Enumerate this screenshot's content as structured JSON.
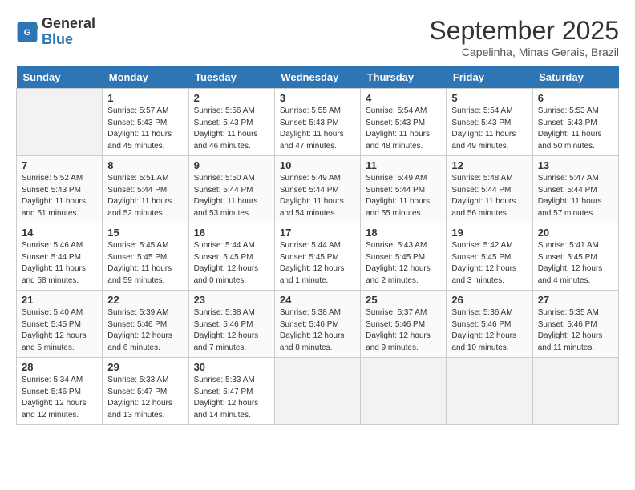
{
  "logo": {
    "line1": "General",
    "line2": "Blue"
  },
  "title": "September 2025",
  "location": "Capelinha, Minas Gerais, Brazil",
  "weekdays": [
    "Sunday",
    "Monday",
    "Tuesday",
    "Wednesday",
    "Thursday",
    "Friday",
    "Saturday"
  ],
  "weeks": [
    [
      {
        "day": "",
        "info": ""
      },
      {
        "day": "1",
        "info": "Sunrise: 5:57 AM\nSunset: 5:43 PM\nDaylight: 11 hours\nand 45 minutes."
      },
      {
        "day": "2",
        "info": "Sunrise: 5:56 AM\nSunset: 5:43 PM\nDaylight: 11 hours\nand 46 minutes."
      },
      {
        "day": "3",
        "info": "Sunrise: 5:55 AM\nSunset: 5:43 PM\nDaylight: 11 hours\nand 47 minutes."
      },
      {
        "day": "4",
        "info": "Sunrise: 5:54 AM\nSunset: 5:43 PM\nDaylight: 11 hours\nand 48 minutes."
      },
      {
        "day": "5",
        "info": "Sunrise: 5:54 AM\nSunset: 5:43 PM\nDaylight: 11 hours\nand 49 minutes."
      },
      {
        "day": "6",
        "info": "Sunrise: 5:53 AM\nSunset: 5:43 PM\nDaylight: 11 hours\nand 50 minutes."
      }
    ],
    [
      {
        "day": "7",
        "info": "Sunrise: 5:52 AM\nSunset: 5:43 PM\nDaylight: 11 hours\nand 51 minutes."
      },
      {
        "day": "8",
        "info": "Sunrise: 5:51 AM\nSunset: 5:44 PM\nDaylight: 11 hours\nand 52 minutes."
      },
      {
        "day": "9",
        "info": "Sunrise: 5:50 AM\nSunset: 5:44 PM\nDaylight: 11 hours\nand 53 minutes."
      },
      {
        "day": "10",
        "info": "Sunrise: 5:49 AM\nSunset: 5:44 PM\nDaylight: 11 hours\nand 54 minutes."
      },
      {
        "day": "11",
        "info": "Sunrise: 5:49 AM\nSunset: 5:44 PM\nDaylight: 11 hours\nand 55 minutes."
      },
      {
        "day": "12",
        "info": "Sunrise: 5:48 AM\nSunset: 5:44 PM\nDaylight: 11 hours\nand 56 minutes."
      },
      {
        "day": "13",
        "info": "Sunrise: 5:47 AM\nSunset: 5:44 PM\nDaylight: 11 hours\nand 57 minutes."
      }
    ],
    [
      {
        "day": "14",
        "info": "Sunrise: 5:46 AM\nSunset: 5:44 PM\nDaylight: 11 hours\nand 58 minutes."
      },
      {
        "day": "15",
        "info": "Sunrise: 5:45 AM\nSunset: 5:45 PM\nDaylight: 11 hours\nand 59 minutes."
      },
      {
        "day": "16",
        "info": "Sunrise: 5:44 AM\nSunset: 5:45 PM\nDaylight: 12 hours\nand 0 minutes."
      },
      {
        "day": "17",
        "info": "Sunrise: 5:44 AM\nSunset: 5:45 PM\nDaylight: 12 hours\nand 1 minute."
      },
      {
        "day": "18",
        "info": "Sunrise: 5:43 AM\nSunset: 5:45 PM\nDaylight: 12 hours\nand 2 minutes."
      },
      {
        "day": "19",
        "info": "Sunrise: 5:42 AM\nSunset: 5:45 PM\nDaylight: 12 hours\nand 3 minutes."
      },
      {
        "day": "20",
        "info": "Sunrise: 5:41 AM\nSunset: 5:45 PM\nDaylight: 12 hours\nand 4 minutes."
      }
    ],
    [
      {
        "day": "21",
        "info": "Sunrise: 5:40 AM\nSunset: 5:45 PM\nDaylight: 12 hours\nand 5 minutes."
      },
      {
        "day": "22",
        "info": "Sunrise: 5:39 AM\nSunset: 5:46 PM\nDaylight: 12 hours\nand 6 minutes."
      },
      {
        "day": "23",
        "info": "Sunrise: 5:38 AM\nSunset: 5:46 PM\nDaylight: 12 hours\nand 7 minutes."
      },
      {
        "day": "24",
        "info": "Sunrise: 5:38 AM\nSunset: 5:46 PM\nDaylight: 12 hours\nand 8 minutes."
      },
      {
        "day": "25",
        "info": "Sunrise: 5:37 AM\nSunset: 5:46 PM\nDaylight: 12 hours\nand 9 minutes."
      },
      {
        "day": "26",
        "info": "Sunrise: 5:36 AM\nSunset: 5:46 PM\nDaylight: 12 hours\nand 10 minutes."
      },
      {
        "day": "27",
        "info": "Sunrise: 5:35 AM\nSunset: 5:46 PM\nDaylight: 12 hours\nand 11 minutes."
      }
    ],
    [
      {
        "day": "28",
        "info": "Sunrise: 5:34 AM\nSunset: 5:46 PM\nDaylight: 12 hours\nand 12 minutes."
      },
      {
        "day": "29",
        "info": "Sunrise: 5:33 AM\nSunset: 5:47 PM\nDaylight: 12 hours\nand 13 minutes."
      },
      {
        "day": "30",
        "info": "Sunrise: 5:33 AM\nSunset: 5:47 PM\nDaylight: 12 hours\nand 14 minutes."
      },
      {
        "day": "",
        "info": ""
      },
      {
        "day": "",
        "info": ""
      },
      {
        "day": "",
        "info": ""
      },
      {
        "day": "",
        "info": ""
      }
    ]
  ]
}
